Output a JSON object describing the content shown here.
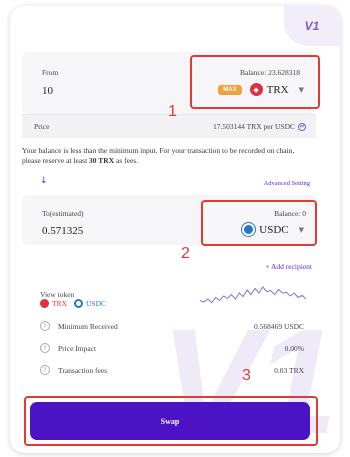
{
  "badge": {
    "version": "V1",
    "watermark": "V1"
  },
  "from": {
    "label": "From",
    "amount": "10",
    "balance": "Balance: 23.628318",
    "max_label": "MAX",
    "token": "TRX"
  },
  "price": {
    "label": "Price",
    "value": "17.503144 TRX per USDC"
  },
  "notice": {
    "line1": "Your balance is less than the minimum input. For your transaction to be recorded on chain,",
    "line2_prefix": "please reserve at least ",
    "line2_bold": "30 TRX",
    "line2_suffix": " as fees."
  },
  "advanced_setting": "Advanced Setting",
  "to": {
    "label": "To(estimated)",
    "amount": "0.571325",
    "balance": "Balance: 0",
    "token": "USDC"
  },
  "add_recipient": "+ Add recipient",
  "view_token": {
    "label": "View token",
    "token_a": "TRX",
    "token_b": "USDC"
  },
  "sparkline": [
    0.55,
    0.6,
    0.5,
    0.62,
    0.45,
    0.55,
    0.4,
    0.48,
    0.35,
    0.5,
    0.3,
    0.42,
    0.2,
    0.35,
    0.15,
    0.3,
    0.1,
    0.25,
    0.22,
    0.35,
    0.18,
    0.3,
    0.28,
    0.4,
    0.3,
    0.45,
    0.38,
    0.5
  ],
  "details": [
    {
      "label": "Minimum Received",
      "value": "0.568469 USDC"
    },
    {
      "label": "Price Impact",
      "value": "0.00%"
    },
    {
      "label": "Transaction fees",
      "value": "0.03 TRX"
    }
  ],
  "swap_button": "Swap",
  "annotations": [
    "1",
    "2",
    "3"
  ],
  "colors": {
    "accent": "#4b13c4",
    "highlight": "#e53935",
    "trx": "#e0313a",
    "usdc": "#2775ca"
  }
}
